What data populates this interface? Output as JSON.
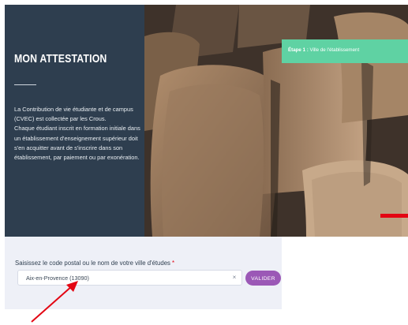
{
  "intro": {
    "title": "MON ATTESTATION",
    "paragraphs": [
      "La Contribution de vie étudiante et de campus (CVEC) est collectée par les Crous.",
      "Chaque étudiant inscrit en formation initiale dans un établissement d'enseignement supérieur doit s'en acquitter avant de s'inscrire dans son établissement, par paiement ou par exonération."
    ]
  },
  "step": {
    "label": "Étape 1 :",
    "text": "Ville de l'établissement"
  },
  "form": {
    "label": "Saisissez le code postal ou le nom de votre ville d'études",
    "required_mark": "*",
    "search_value": "Aix-en-Provence (13090)",
    "clear_symbol": "×",
    "submit_label": "VALIDER"
  },
  "colors": {
    "panel": "#2e3e4f",
    "step_banner": "#5fd2a3",
    "button": "#9b58b6",
    "accent_red": "#e30613"
  }
}
